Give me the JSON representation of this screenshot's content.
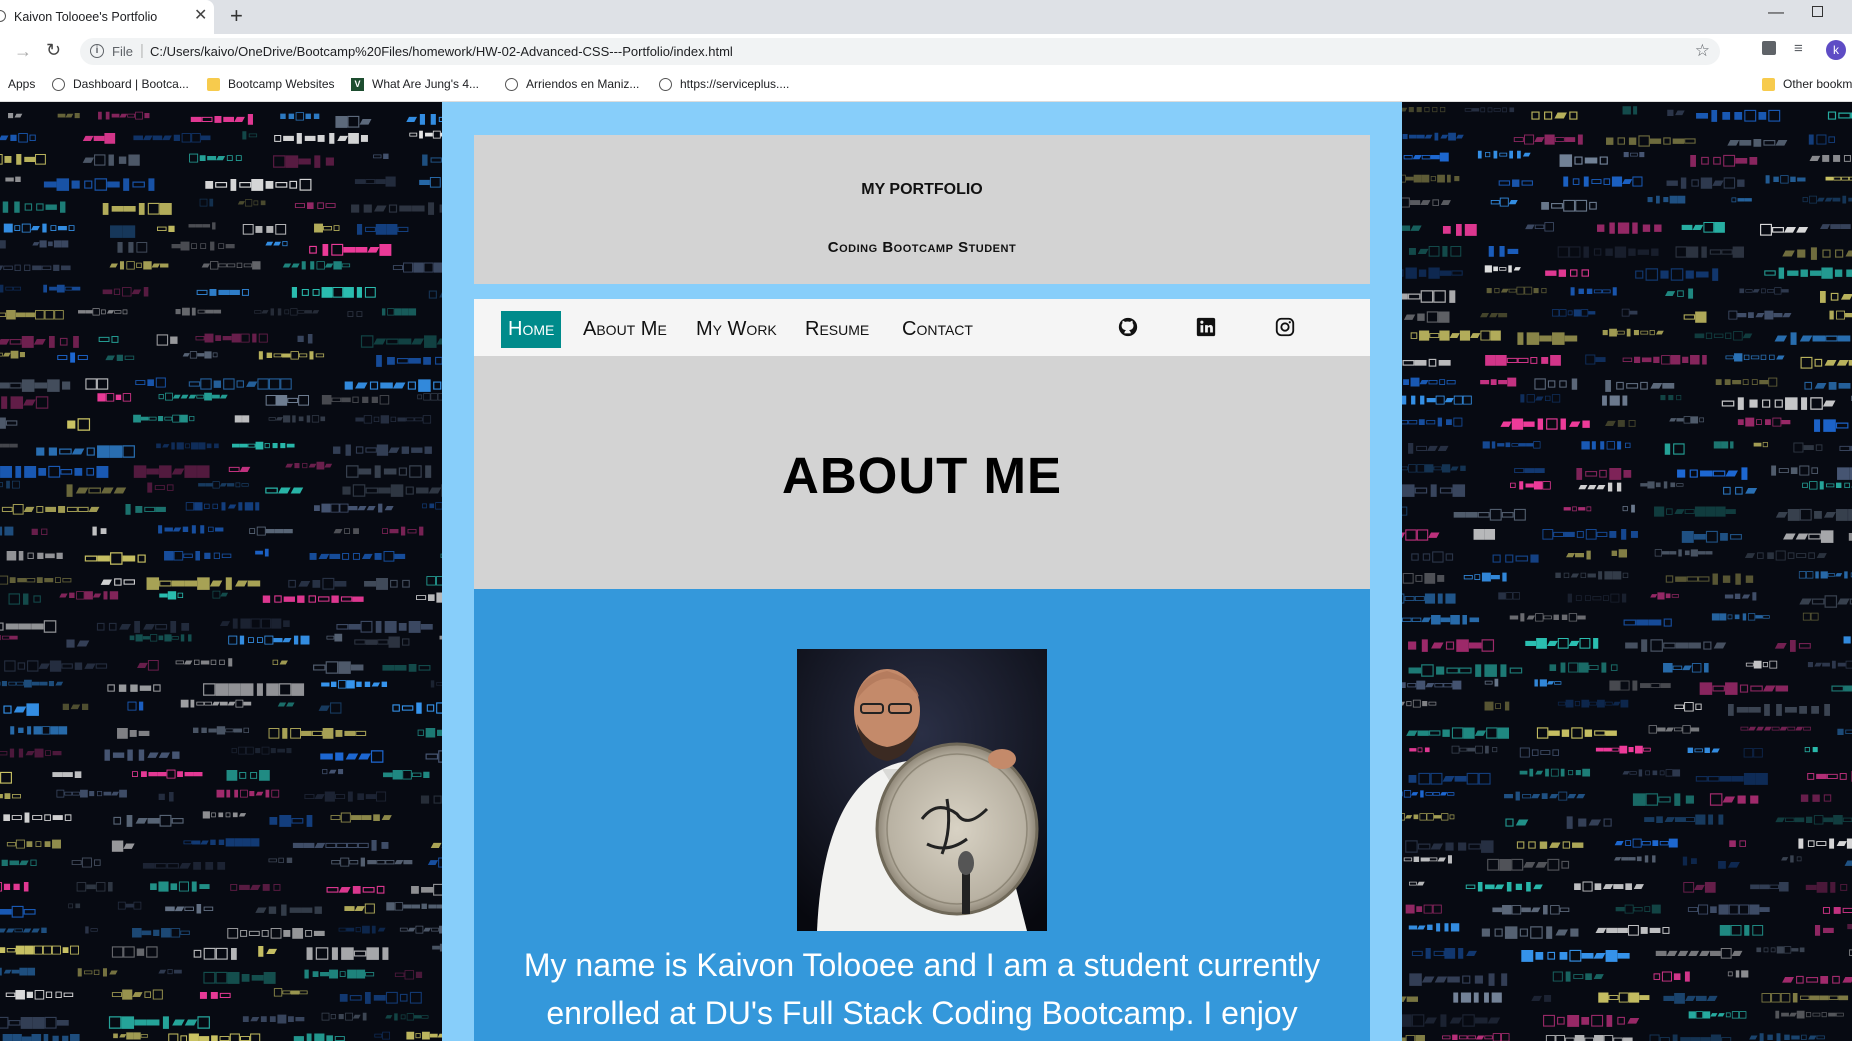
{
  "browser": {
    "tab_title": "Kaivon Tolooee's Portfolio",
    "tab_close": "✕",
    "new_tab": "+",
    "url_scheme": "File",
    "url": "C:/Users/kaivo/OneDrive/Bootcamp%20Files/homework/HW-02-Advanced-CSS---Portfolio/index.html",
    "profile_initial": "k",
    "bookmarks": [
      {
        "label": "Apps",
        "icon": "apps-icon"
      },
      {
        "label": "Dashboard | Bootca...",
        "icon": "globe-icon"
      },
      {
        "label": "Bootcamp Websites",
        "icon": "folder-icon"
      },
      {
        "label": "What Are Jung's 4...",
        "icon": "v-logo-icon"
      },
      {
        "label": "Arriendos en Maniz...",
        "icon": "globe-icon"
      },
      {
        "label": "https://serviceplus....",
        "icon": "globe-icon"
      }
    ],
    "other_bookmarks": "Other bookm"
  },
  "header": {
    "title": "MY PORTFOLIO",
    "subtitle": "Coding Bootcamp Student"
  },
  "nav": {
    "items": [
      "Home",
      "About Me",
      "My Work",
      "Resume",
      "Contact"
    ],
    "active": "Home",
    "social_icons": [
      "github-icon",
      "linkedin-icon",
      "instagram-icon"
    ]
  },
  "about": {
    "title": "ABOUT ME",
    "text": "My name is Kaivon Tolooee and I am a student currently enrolled at DU's Full Stack Coding Bootcamp. I enjoy"
  },
  "colors": {
    "page_background": "#87cefa",
    "header_background": "#d3d3d3",
    "nav_active": "#008b8b",
    "about_background": "#3498db"
  }
}
